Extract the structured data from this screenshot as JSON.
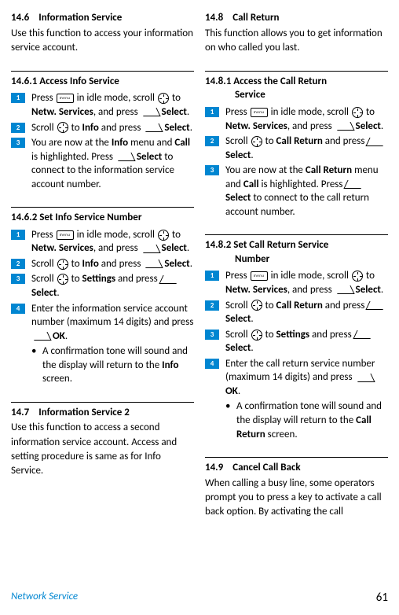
{
  "labels": {
    "menu": "menu"
  },
  "left": {
    "s1": {
      "num": "14.6",
      "title": "Information Service",
      "body": "Use this function to access your information service account."
    },
    "s2": {
      "title": "14.6.1 Access Info Service",
      "st1a": "Press ",
      "st1b": " in idle mode, scroll ",
      "st1c": " to ",
      "st1d": "Netw. Services",
      "st1e": ", and press ",
      "st1f": "Select",
      "st1g": ".",
      "st2a": "Scroll ",
      "st2b": " to ",
      "st2c": "Info",
      "st2d": " and press ",
      "st2e": "Select",
      "st2f": ".",
      "st3a": "You are now at the ",
      "st3b": "Info",
      "st3c": " menu and ",
      "st3d": "Call",
      "st3e": " is highlighted. Press ",
      "st3f": "Select",
      "st3g": " to connect to the information service account number."
    },
    "s3": {
      "title": "14.6.2 Set Info Service Number",
      "st1a": "Press ",
      "st1b": " in idle mode, scroll ",
      "st1c": " to ",
      "st1d": "Netw. Services",
      "st1e": ", and press ",
      "st1f": "Select",
      "st1g": ".",
      "st2a": "Scroll ",
      "st2b": " to ",
      "st2c": "Info",
      "st2d": " and press ",
      "st2e": "Select",
      "st2f": ".",
      "st3a": "Scroll ",
      "st3b": " to ",
      "st3c": "Settings",
      "st3d": " and press ",
      "st3e": "Select",
      "st3f": ".",
      "st4a": "Enter the information service account number (maximum 14 digits) and press ",
      "st4b": "OK",
      "st4c": ".",
      "bul_a": "A confirmation tone will sound and the display will return to the ",
      "bul_b": "Info",
      "bul_c": " screen."
    },
    "s4": {
      "num": "14.7",
      "title": "Information Service 2",
      "body": "Use this function to access a second information service account. Access and setting procedure is same as for Info Service."
    }
  },
  "right": {
    "s1": {
      "num": "14.8",
      "title": "Call Return",
      "body": "This function allows you to get information on who called you last."
    },
    "s2": {
      "title_a": "14.8.1 Access the Call Return",
      "title_b": "Service",
      "st1a": "Press ",
      "st1b": " in idle mode, scroll ",
      "st1c": " to ",
      "st1d": "Netw. Services",
      "st1e": ", and press ",
      "st1f": "Select",
      "st1g": ".",
      "st2a": "Scroll ",
      "st2b": " to ",
      "st2c": "Call Return",
      "st2d": " and press ",
      "st2e": "Select",
      "st2f": ".",
      "st3a": "You are now at the ",
      "st3b": "Call Return",
      "st3c": " menu and ",
      "st3d": "Call",
      "st3e": " is highlighted. Press ",
      "st3f": "Select",
      "st3g": " to connect to the call return account number."
    },
    "s3": {
      "title_a": "14.8.2 Set Call Return Service",
      "title_b": "Number",
      "st1a": "Press ",
      "st1b": " in idle mode, scroll ",
      "st1c": " to ",
      "st1d": "Netw. Services",
      "st1e": ", and press ",
      "st1f": "Select",
      "st1g": ".",
      "st2a": "Scroll ",
      "st2b": " to ",
      "st2c": "Call Return",
      "st2d": " and press ",
      "st2e": "Select",
      "st2f": ".",
      "st3a": "Scroll ",
      "st3b": " to ",
      "st3c": "Settings",
      "st3d": " and press ",
      "st3e": "Select",
      "st3f": ".",
      "st4a": "Enter the call return service number (maximum 14 digits) and press ",
      "st4b": "OK",
      "st4c": ".",
      "bul_a": "A confirmation tone will sound and the display will return to the ",
      "bul_b": "Call Return",
      "bul_c": " screen."
    },
    "s4": {
      "num": "14.9",
      "title": "Cancel Call Back",
      "body": "When calling a busy line, some operators prompt you to press a key to activate a call back option. By activating the call"
    }
  },
  "footer": {
    "left": "Network Service",
    "page": "61"
  },
  "nums": {
    "n1": "1",
    "n2": "2",
    "n3": "3",
    "n4": "4"
  },
  "bullet": "•"
}
